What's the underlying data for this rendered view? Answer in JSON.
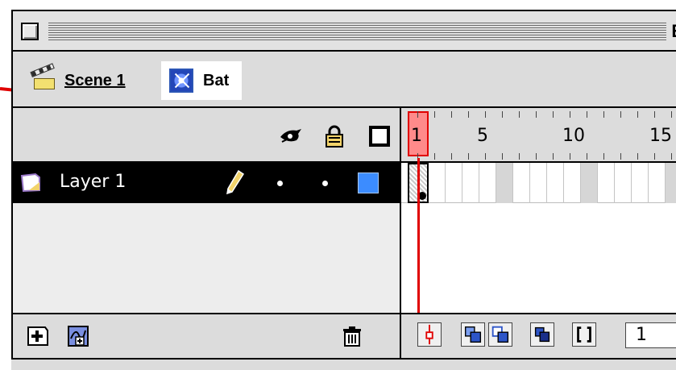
{
  "window": {
    "title_partial": "E",
    "close_box": "close-box"
  },
  "breadcrumb": {
    "scene_label": "Scene 1",
    "scene_icon": "clapperboard-icon",
    "symbol_label": "Bat",
    "symbol_icon": "movie-clip-symbol-icon"
  },
  "annotation": {
    "arrow_color": "#e00000",
    "arrow_icon": "red-arrow-icon"
  },
  "layers": {
    "header_icons": [
      "eye-icon",
      "lock-icon",
      "outline-icon"
    ],
    "rows": [
      {
        "name": "Layer 1",
        "icon": "layer-icon",
        "edit_icon": "pencil-icon",
        "visible_marker": "•",
        "lock_marker": "•",
        "outline_color": "#3c8cff",
        "selected": true
      }
    ],
    "footer_icons": [
      "add-layer-icon",
      "add-guide-layer-icon",
      "trash-icon"
    ]
  },
  "timeline": {
    "ruler_labels": [
      "1",
      "5",
      "10",
      "15"
    ],
    "current_frame": "1",
    "playhead_color": "#e00000",
    "footer_buttons": [
      "center-frame-icon",
      "onion-skin-icon",
      "onion-skin-outlines-icon",
      "edit-multiple-frames-icon",
      "modify-onion-markers-icon"
    ]
  },
  "colors": {
    "chrome": "#dcdcdc",
    "selection": "#000000",
    "accent": "#3c8cff"
  }
}
